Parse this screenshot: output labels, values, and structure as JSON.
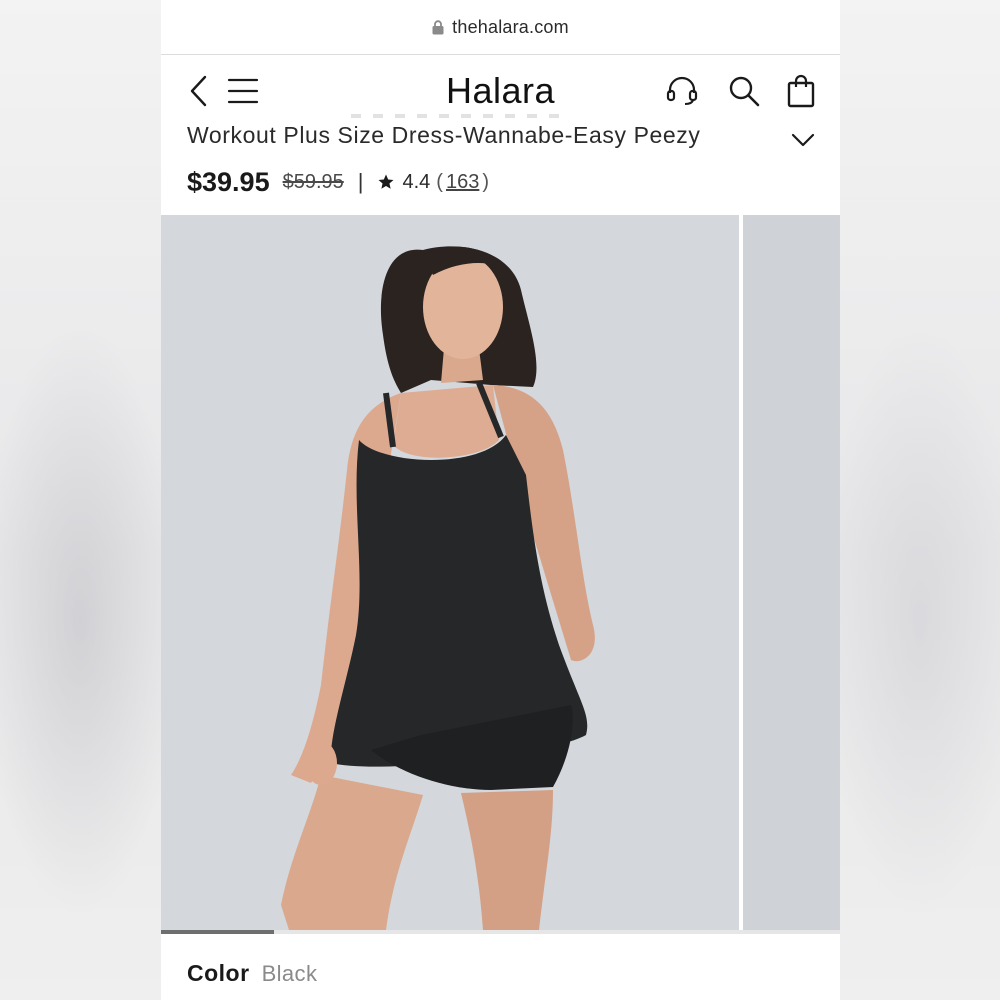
{
  "browser": {
    "url": "thehalara.com"
  },
  "header": {
    "brand": "Halara",
    "icons": [
      "back-icon",
      "menu-icon",
      "headset-icon",
      "search-icon",
      "shopping-bag-icon"
    ]
  },
  "product": {
    "title": "Workout Plus Size Dress-Wannabe-Easy Peezy",
    "price_now": "$39.95",
    "price_was": "$59.95",
    "divider": "|",
    "rating": "4.4",
    "paren_open": "(",
    "reviews": "163",
    "paren_close": ")"
  },
  "gallery": {
    "slide_index": 1,
    "slide_count": 6
  },
  "variant": {
    "label": "Color",
    "value": "Black"
  },
  "colors": {
    "dress": "#262728",
    "background": "#d4d7db",
    "accent": "#1a1a1a"
  }
}
